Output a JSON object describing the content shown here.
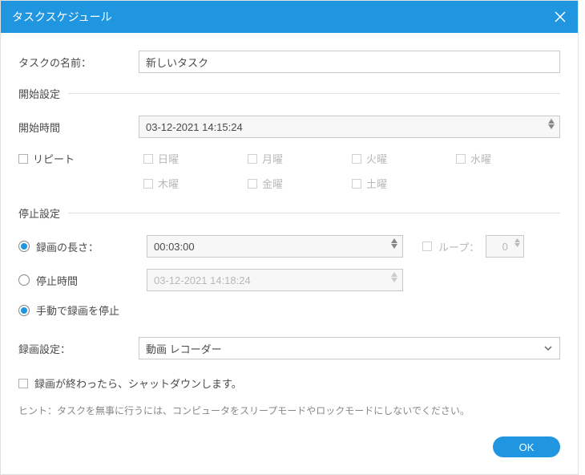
{
  "titlebar": {
    "title": "タスクスケジュール"
  },
  "task_name": {
    "label": "タスクの名前：",
    "value": "新しいタスク"
  },
  "start_section": {
    "header": "開始設定",
    "start_time_label": "開始時間",
    "start_time_value": "03-12-2021 14:15:24",
    "repeat_label": "リピート",
    "days": {
      "sun": "日曜",
      "mon": "月曜",
      "tue": "火曜",
      "wed": "水曜",
      "thu": "木曜",
      "fri": "金曜",
      "sat": "土曜"
    }
  },
  "stop_section": {
    "header": "停止設定",
    "length_label": "録画の長さ：",
    "length_value": "00:03:00",
    "loop_label": "ループ：",
    "loop_value": "0",
    "stop_time_label": "停止時間",
    "stop_time_value": "03-12-2021 14:18:24",
    "manual_stop_label": "手動で録画を停止"
  },
  "record_section": {
    "label": "録画設定：",
    "value": "動画 レコーダー"
  },
  "shutdown": {
    "label": "録画が終わったら、シャットダウンします。"
  },
  "hint": "ヒント：タスクを無事に行うには、コンピュータをスリープモードやロックモードにしないでください。",
  "footer": {
    "ok": "OK"
  }
}
